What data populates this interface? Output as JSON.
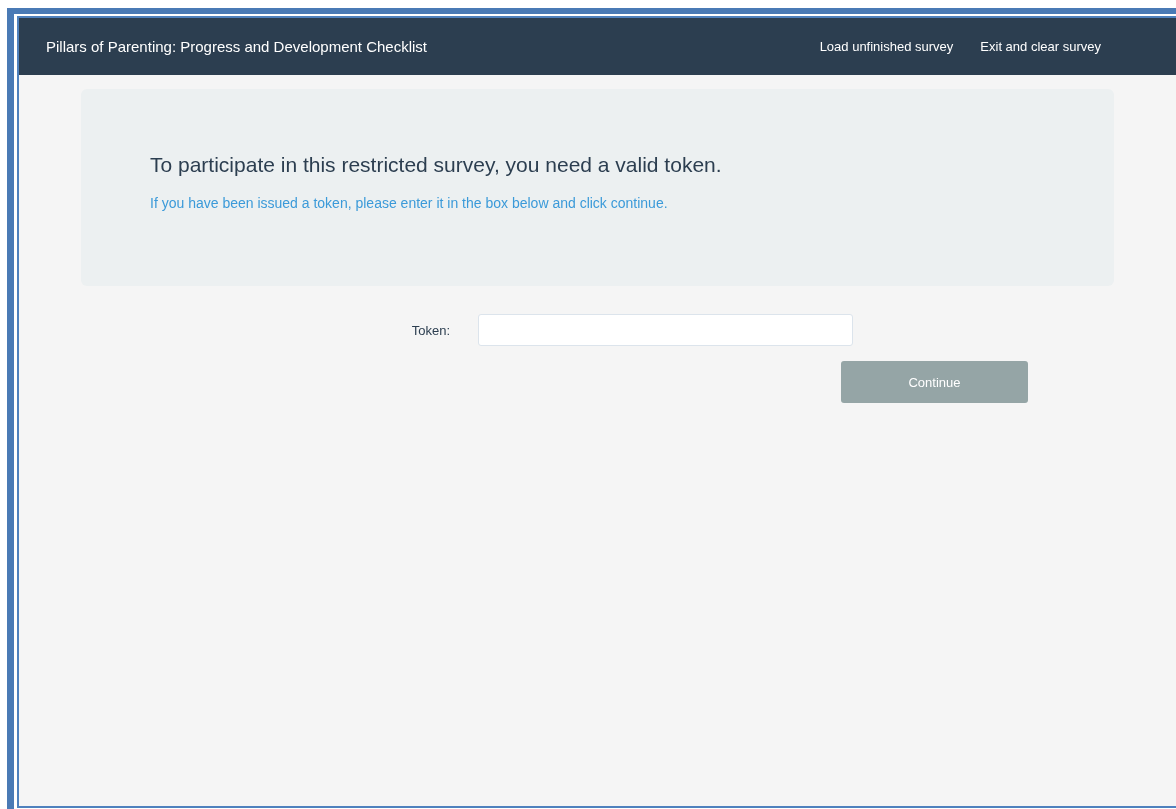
{
  "navbar": {
    "title": "Pillars of Parenting: Progress and Development Checklist",
    "links": [
      "Load unfinished survey",
      "Exit and clear survey"
    ]
  },
  "notice": {
    "heading": "To participate in this restricted survey, you need a valid token.",
    "message": "If you have been issued a token, please enter it in the box below and click continue."
  },
  "form": {
    "label": "Token:",
    "button": "Continue"
  }
}
